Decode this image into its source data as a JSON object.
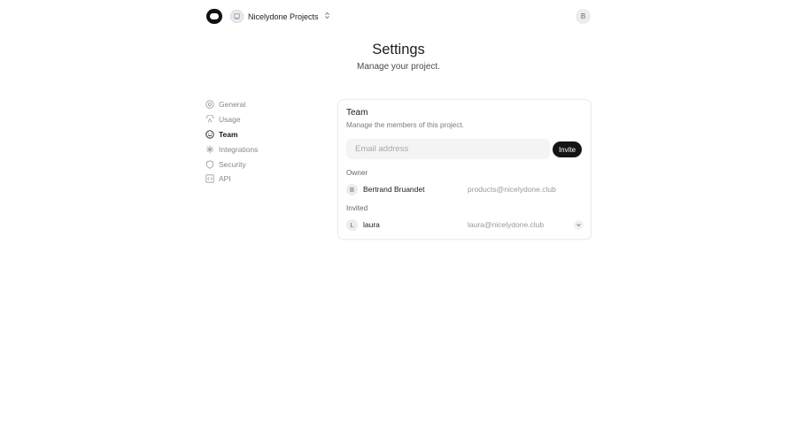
{
  "header": {
    "logo_icon": "logo-icon",
    "project_name": "Nicelydone Projects",
    "project_switch_icon": "chevron-up-down-icon",
    "user_initial": "B"
  },
  "page": {
    "title": "Settings",
    "subtitle": "Manage your project."
  },
  "sidebar": {
    "items": [
      {
        "label": "General",
        "icon": "gear-icon",
        "active": false
      },
      {
        "label": "Usage",
        "icon": "usage-icon",
        "active": false
      },
      {
        "label": "Team",
        "icon": "smiley-icon",
        "active": true
      },
      {
        "label": "Integrations",
        "icon": "sparkle-icon",
        "active": false
      },
      {
        "label": "Security",
        "icon": "shield-icon",
        "active": false
      },
      {
        "label": "API",
        "icon": "code-icon",
        "active": false
      }
    ]
  },
  "team": {
    "title": "Team",
    "description": "Manage the members of this project.",
    "email_placeholder": "Email address",
    "email_value": "",
    "invite_label": "Invite",
    "owner_label": "Owner",
    "owner": {
      "initial": "B",
      "name": "Bertrand Bruandet",
      "email": "products@nicelydone.club"
    },
    "invited_label": "Invited",
    "invited": [
      {
        "initial": "L",
        "name": "laura",
        "email": "laura@nicelydone.club",
        "menu_icon": "chevron-down-icon"
      }
    ]
  },
  "colors": {
    "accent": "#141414",
    "muted_text": "#888888",
    "input_bg": "#f4f4f4"
  }
}
